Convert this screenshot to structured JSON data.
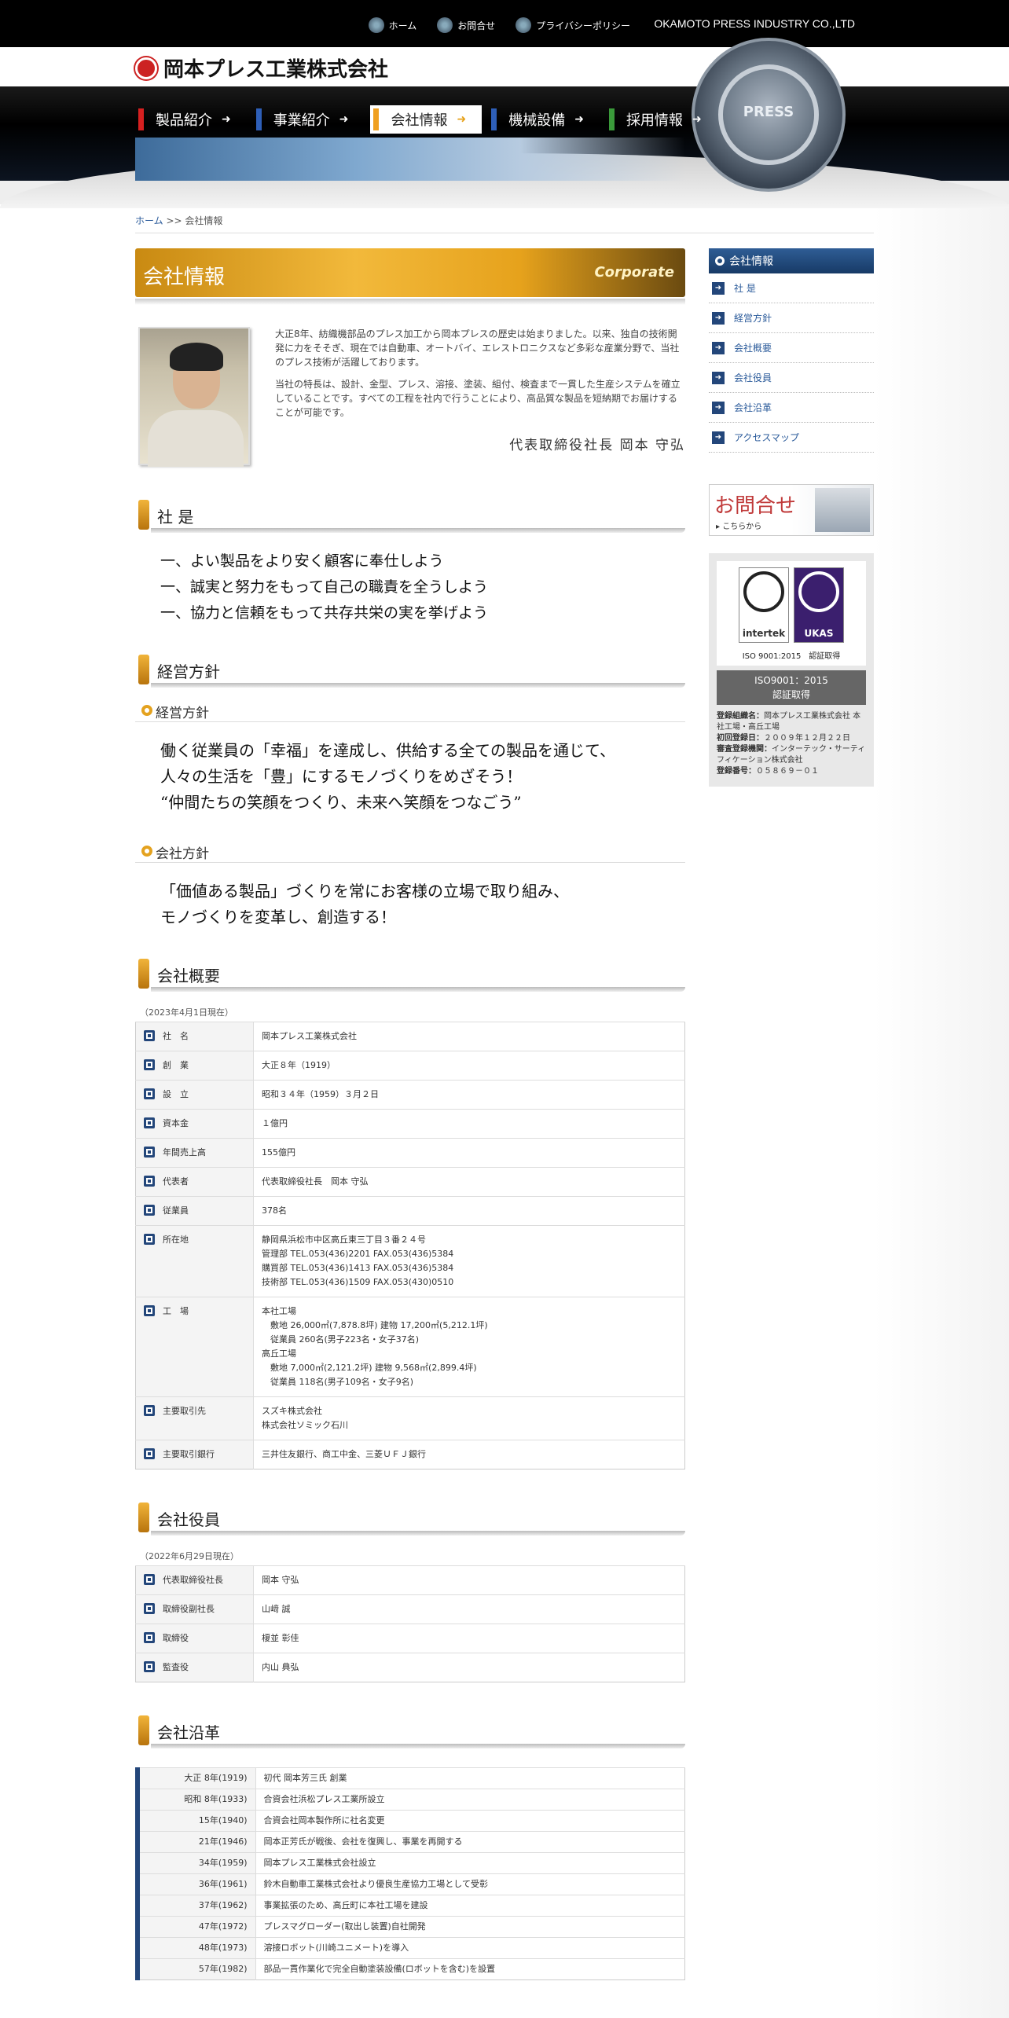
{
  "header": {
    "top_links": [
      {
        "label": "ホーム",
        "icon": "home-icon"
      },
      {
        "label": "お問合せ",
        "icon": "mail-icon"
      },
      {
        "label": "プライバシーポリシー",
        "icon": "privacy-icon"
      }
    ],
    "brand_en": "OKAMOTO PRESS INDUSTRY CO.,LTD",
    "brand_jp": "岡本プレス工業株式会社",
    "seal_text": "PRESS",
    "nav": [
      {
        "label": "製品紹介",
        "color": "#d62020"
      },
      {
        "label": "事業紹介",
        "color": "#2e5fb8"
      },
      {
        "label": "会社情報",
        "color": "#f0a020"
      },
      {
        "label": "機械設備",
        "color": "#2e5fb8"
      },
      {
        "label": "採用情報",
        "color": "#3a9a3a"
      }
    ]
  },
  "breadcrumb": {
    "home": "ホーム",
    "sep": ">>",
    "current": "会社情報"
  },
  "hero": {
    "title": "会社情報",
    "subtitle": "Corporate"
  },
  "intro": {
    "p1": "大正8年、紡織機部品のプレス加工から岡本プレスの歴史は始まりました。以来、独自の技術開発に力をそそぎ、現在では自動車、オートバイ、エレストロニクスなど多彩な産業分野で、当社のプレス技術が活躍しております。",
    "p2": "当社の特長は、設計、金型、プレス、溶接、塗装、組付、検査まで一貫した生産システムを確立していることです。すべての工程を社内で行うことにより、高品質な製品を短納期でお届けすることが可能です。",
    "signature": "代表取締役社長 岡本 守弘"
  },
  "sections": {
    "motto_title": "社 是",
    "motto": [
      "一、よい製品をより安く顧客に奉仕しよう",
      "一、誠実と努力をもって自己の職責を全うしよう",
      "一、協力と信頼をもって共存共栄の実を挙げよう"
    ],
    "policy_title": "経営方針",
    "policy_sub1": "経営方針",
    "policy1": [
      "働く従業員の「幸福」を達成し、供給する全ての製品を通じて、",
      "人々の生活を「豊」にするモノづくりをめざそう！",
      "“仲間たちの笑顔をつくり、未来へ笑顔をつなごう”"
    ],
    "policy_sub2": "会社方針",
    "policy2": [
      "「価値ある製品」づくりを常にお客様の立場で取り組み、",
      "モノづくりを変革し、創造する！"
    ],
    "overview_title": "会社概要",
    "overview_note": "（2023年4月1日現在）",
    "officers_title": "会社役員",
    "officers_note": "（2022年6月29日現在）",
    "history_title": "会社沿革"
  },
  "overview": [
    {
      "k": "社　名",
      "v": "岡本プレス工業株式会社"
    },
    {
      "k": "創　業",
      "v": "大正８年（1919）"
    },
    {
      "k": "設　立",
      "v": "昭和３４年（1959）３月２日"
    },
    {
      "k": "資本金",
      "v": "１億円"
    },
    {
      "k": "年間売上高",
      "v": "155億円"
    },
    {
      "k": "代表者",
      "v": "代表取締役社長　岡本 守弘"
    },
    {
      "k": "従業員",
      "v": "378名"
    },
    {
      "k": "所在地",
      "v": "静岡県浜松市中区高丘東三丁目３番２４号\n管理部 TEL.053(436)2201 FAX.053(436)5384\n購買部 TEL.053(436)1413 FAX.053(436)5384\n技術部 TEL.053(436)1509 FAX.053(430)0510"
    },
    {
      "k": "工　場",
      "v": "本社工場\n　敷地 26,000㎡(7,878.8坪) 建物 17,200㎡(5,212.1坪)\n　従業員 260名(男子223名・女子37名)\n高丘工場\n　敷地 7,000㎡(2,121.2坪) 建物 9,568㎡(2,899.4坪)\n　従業員 118名(男子109名・女子9名)"
    },
    {
      "k": "主要取引先",
      "v": "スズキ株式会社\n株式会社ソミック石川"
    },
    {
      "k": "主要取引銀行",
      "v": "三井住友銀行、商工中金、三菱ＵＦＪ銀行"
    }
  ],
  "officers": [
    {
      "k": "代表取締役社長",
      "v": "岡本 守弘"
    },
    {
      "k": "取締役副社長",
      "v": "山﨑 誠"
    },
    {
      "k": "取締役",
      "v": "榎並 彰佳"
    },
    {
      "k": "監査役",
      "v": "内山 典弘"
    }
  ],
  "history": [
    {
      "y": "大正 8年(1919)",
      "v": "初代 岡本芳三氏 創業"
    },
    {
      "y": "昭和 8年(1933)",
      "v": "合資会社浜松プレス工業所設立"
    },
    {
      "y": "15年(1940)",
      "v": "合資会社岡本製作所に社名変更"
    },
    {
      "y": "21年(1946)",
      "v": "岡本正芳氏が戦後、会社を復興し、事業を再開する"
    },
    {
      "y": "34年(1959)",
      "v": "岡本プレス工業株式会社設立"
    },
    {
      "y": "36年(1961)",
      "v": "鈴木自動車工業株式会社より優良生産協力工場として受彰"
    },
    {
      "y": "37年(1962)",
      "v": "事業拡張のため、高丘町に本社工場を建設"
    },
    {
      "y": "47年(1972)",
      "v": "プレスマグローダー(取出し装置)自社開発"
    },
    {
      "y": "48年(1973)",
      "v": "溶接ロボット(川崎ユニメート)を導入"
    },
    {
      "y": "57年(1982)",
      "v": "部品一貫作業化で完全自動塗装設備(ロボットを含む)を設置"
    }
  ],
  "sidebar": {
    "title": "会社情報",
    "items": [
      "社 是",
      "経営方針",
      "会社概要",
      "会社役員",
      "会社沿革",
      "アクセスマップ"
    ],
    "contact_title": "お問合せ",
    "contact_sub": "こちらから",
    "iso_logo1": "intertek",
    "iso_logo2": "UKAS",
    "iso_caption": "ISO 9001:2015　認証取得",
    "iso_badge1": "ISO9001：2015",
    "iso_badge2": "認証取得",
    "iso_details": [
      {
        "k": "登録組織名：",
        "v": "岡本プレス工業株式会社 本社工場・高丘工場"
      },
      {
        "k": "初回登録日：",
        "v": "２００９年１２月２２日"
      },
      {
        "k": "審査登録機関：",
        "v": "インターテック・サーティフィケーション株式会社"
      },
      {
        "k": "登録番号：",
        "v": "０５８６９－０１"
      }
    ]
  }
}
